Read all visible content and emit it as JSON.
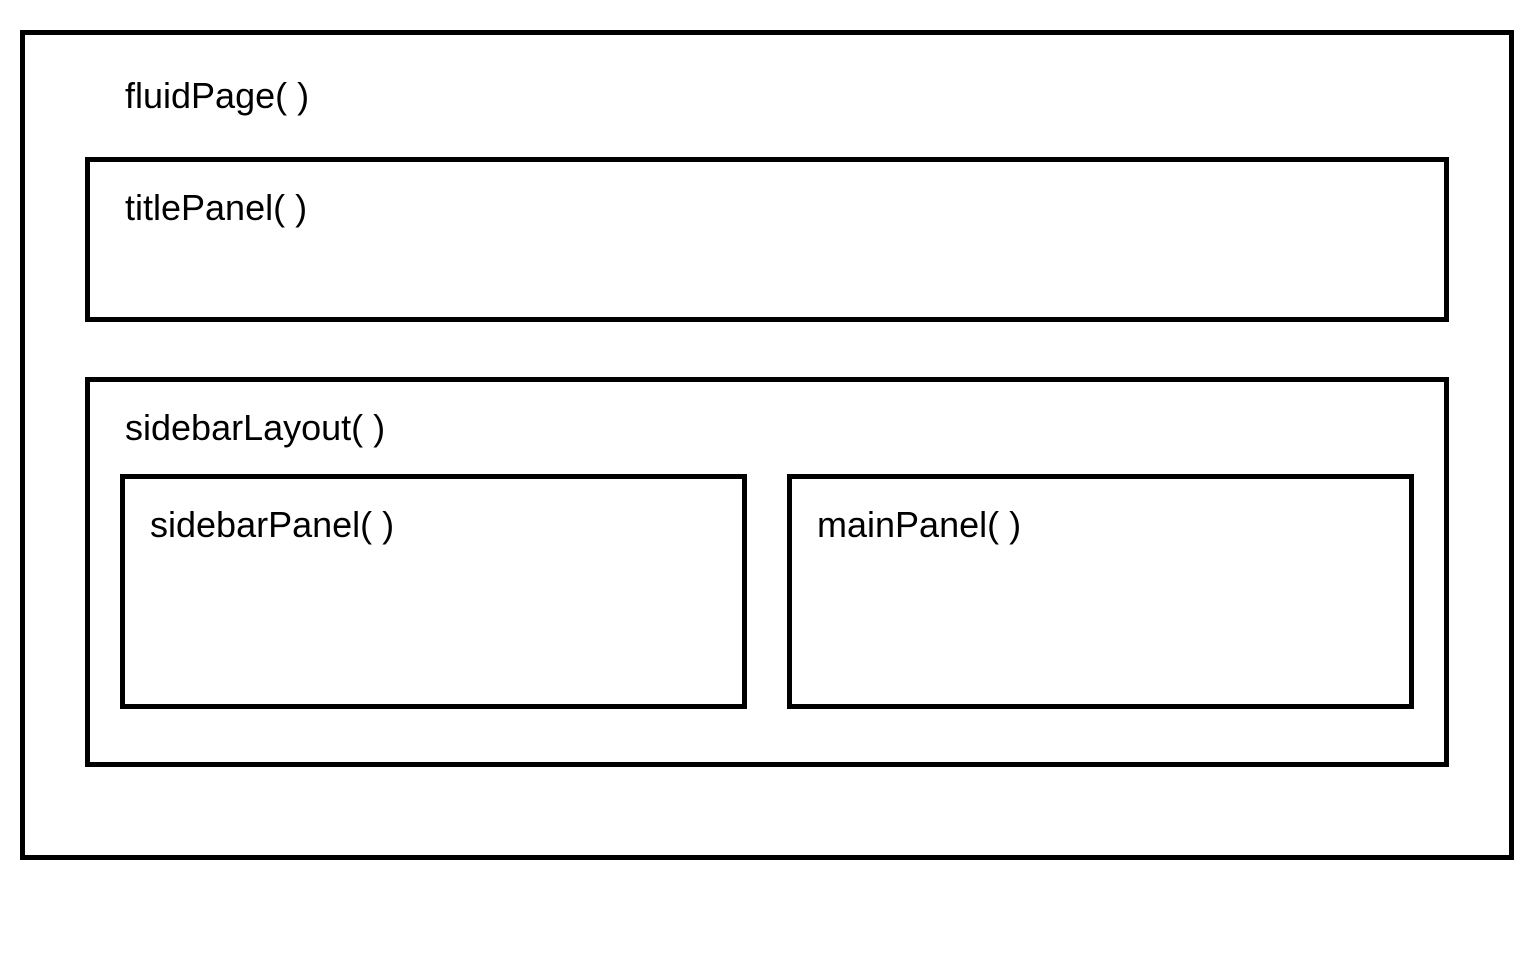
{
  "diagram": {
    "outer_label": "fluidPage( )",
    "title_panel_label": "titlePanel( )",
    "sidebar_layout_label": "sidebarLayout( )",
    "sidebar_panel_label": "sidebarPanel( )",
    "main_panel_label": "mainPanel( )"
  }
}
